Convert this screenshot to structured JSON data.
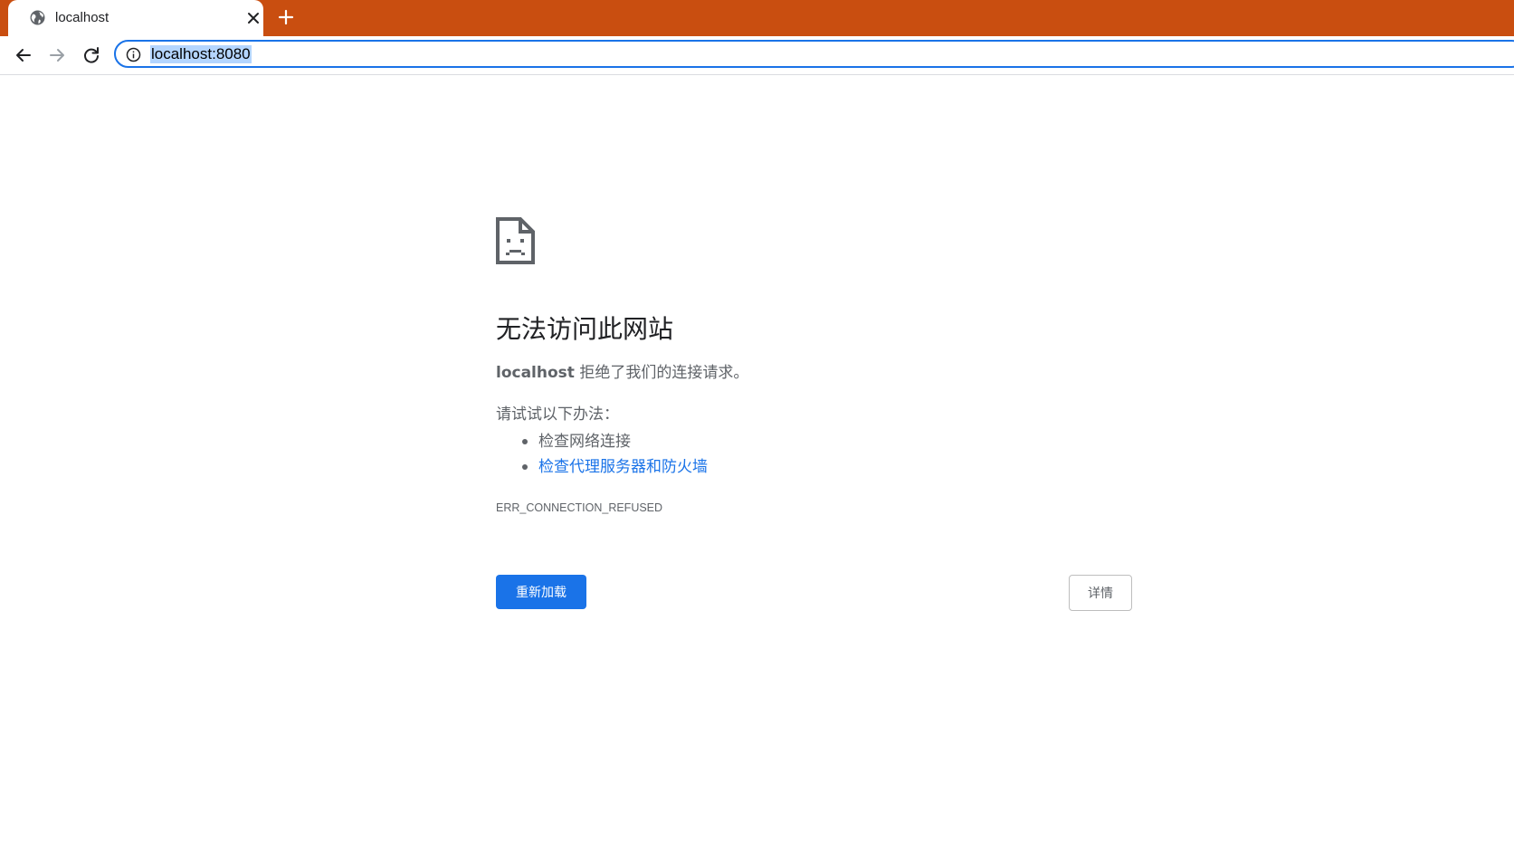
{
  "browser": {
    "tab": {
      "title": "localhost",
      "favicon": "globe-icon",
      "close_icon": "close-icon"
    },
    "new_tab_icon": "plus-icon",
    "toolbar": {
      "back_icon": "back-arrow-icon",
      "forward_icon": "forward-arrow-icon",
      "reload_icon": "reload-icon",
      "site_info_icon": "info-icon",
      "url": "localhost:8080"
    },
    "colors": {
      "tabstrip": "#C94E10",
      "accent": "#1a73e8"
    }
  },
  "error_page": {
    "icon": "sad-page-icon",
    "heading": "无法访问此网站",
    "host": "localhost",
    "description": "拒绝了我们的连接请求。",
    "try_label": "请试试以下办法：",
    "suggestions": [
      {
        "text": "检查网络连接",
        "is_link": false
      },
      {
        "text": "检查代理服务器和防火墙",
        "is_link": true
      }
    ],
    "error_code": "ERR_CONNECTION_REFUSED",
    "reload_button": "重新加载",
    "details_button": "详情"
  }
}
